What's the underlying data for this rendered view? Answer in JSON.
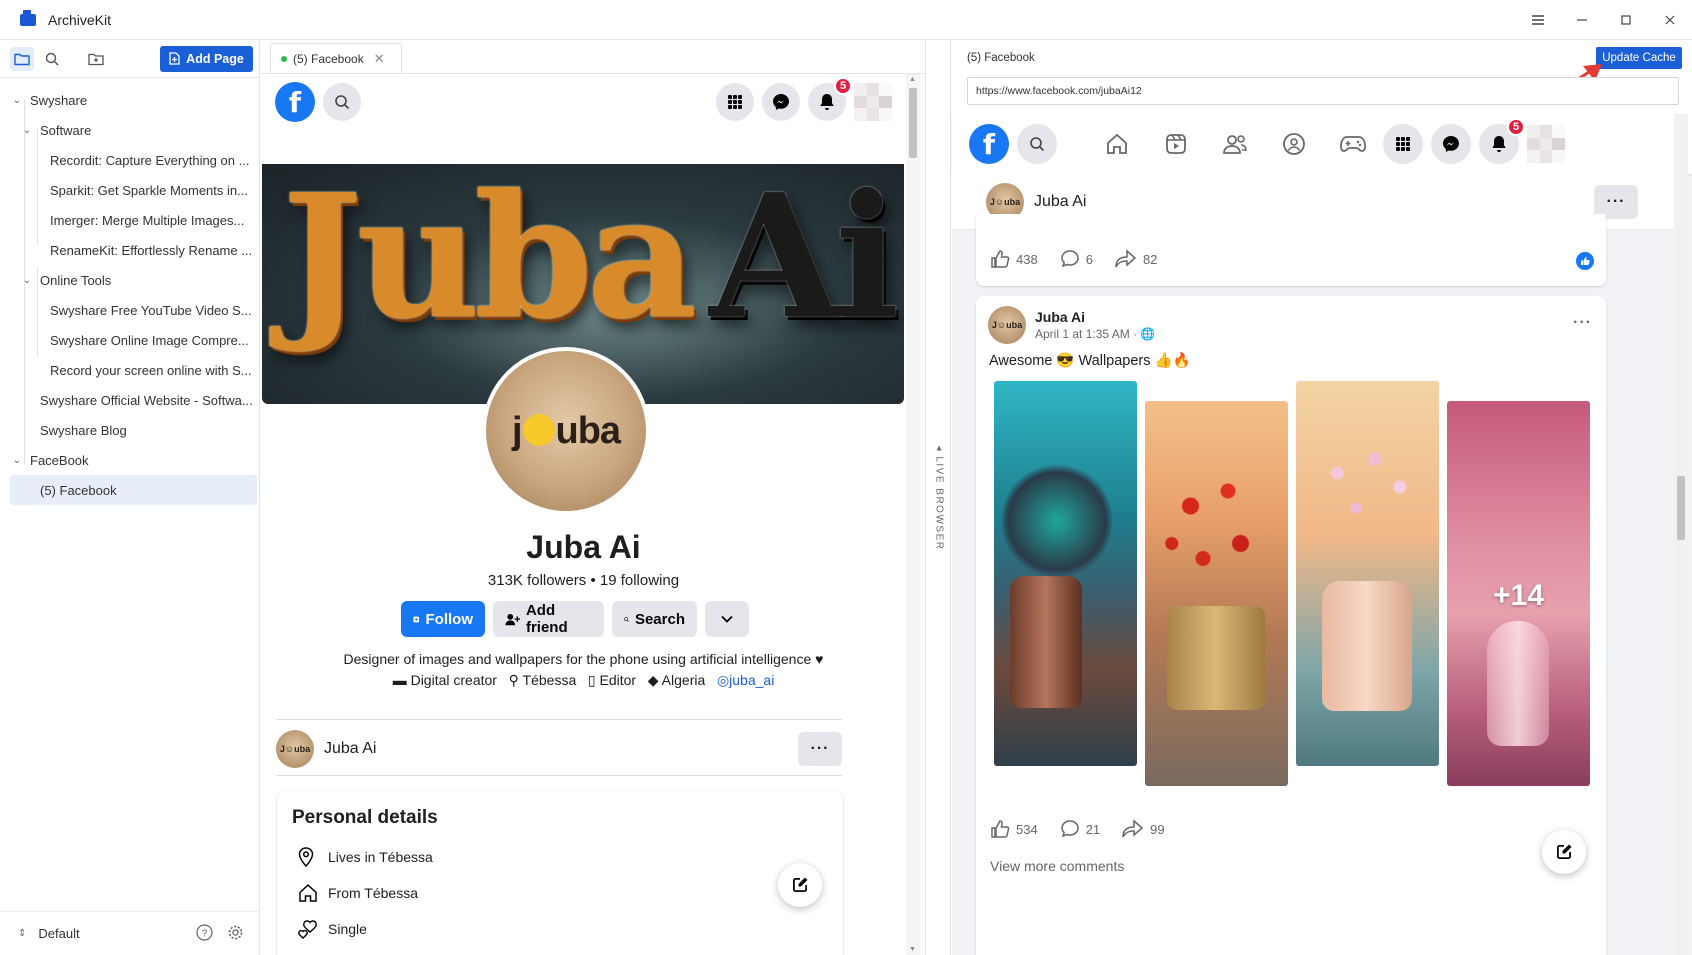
{
  "app": {
    "title": "ArchiveKit"
  },
  "sidebar": {
    "add_page_label": "Add Page",
    "tree": [
      {
        "label": "Swyshare",
        "level": 0,
        "expandable": true
      },
      {
        "label": "Software",
        "level": 1,
        "expandable": true
      },
      {
        "label": "Recordit: Capture Everything on ...",
        "level": 2
      },
      {
        "label": "Sparkit: Get Sparkle Moments in...",
        "level": 2
      },
      {
        "label": "Imerger: Merge Multiple Images...",
        "level": 2
      },
      {
        "label": "RenameKit: Effortlessly Rename ...",
        "level": 2
      },
      {
        "label": "Online Tools",
        "level": 1,
        "expandable": true
      },
      {
        "label": "Swyshare Free YouTube Video S...",
        "level": 2
      },
      {
        "label": "Swyshare Online Image Compre...",
        "level": 2
      },
      {
        "label": "Record your screen online with S...",
        "level": 2
      },
      {
        "label": "Swyshare Official Website - Softwa...",
        "level": 1
      },
      {
        "label": "Swyshare Blog",
        "level": 1
      },
      {
        "label": "FaceBook",
        "level": 0,
        "expandable": true
      },
      {
        "label": "(5) Facebook",
        "level": 1,
        "selected": true
      }
    ],
    "profile_label": "Default"
  },
  "middle": {
    "tab_label": "(5) Facebook",
    "notifications_count": "5",
    "profile": {
      "name": "Juba Ai",
      "stats": "313K followers • 19 following",
      "follow_label": "Follow",
      "add_friend_label": "Add friend",
      "search_label": "Search",
      "bio": "Designer of images and wallpapers for the phone using artificial intelligence ♥",
      "meta": {
        "category": "Digital creator",
        "location": "Tébessa",
        "role": "Editor",
        "country": "Algeria",
        "instagram": "juba_ai"
      },
      "cover_text_1": "Juba",
      "cover_text_2": "Ai",
      "avatar_text_left": "j",
      "avatar_text_right": "uba"
    },
    "post_author": "Juba Ai",
    "details": {
      "title": "Personal details",
      "lives": "Lives in Tébessa",
      "from": "From Tébessa",
      "relationship": "Single"
    }
  },
  "live_browser_label": "LIVE BROWSER",
  "right": {
    "page_title": "(5) Facebook",
    "update_cache_label": "Update Cache",
    "url": "https://www.facebook.com/jubaAi12",
    "notifications_count": "5",
    "post1": {
      "author": "Juba Ai",
      "likes": "438",
      "comments": "6",
      "shares": "82"
    },
    "post2": {
      "author": "Juba Ai",
      "time": "April 1 at 1:35 AM ·",
      "text": "Awesome 😎 Wallpapers 👍🔥",
      "more_count": "+14",
      "likes": "534",
      "comments": "21",
      "shares": "99",
      "view_more": "View more comments"
    }
  },
  "colors": {
    "accent": "#1a5fd6",
    "facebook_blue": "#1877f2",
    "badge_red": "#e41e3f",
    "annotation_arrow": "#e53935"
  }
}
